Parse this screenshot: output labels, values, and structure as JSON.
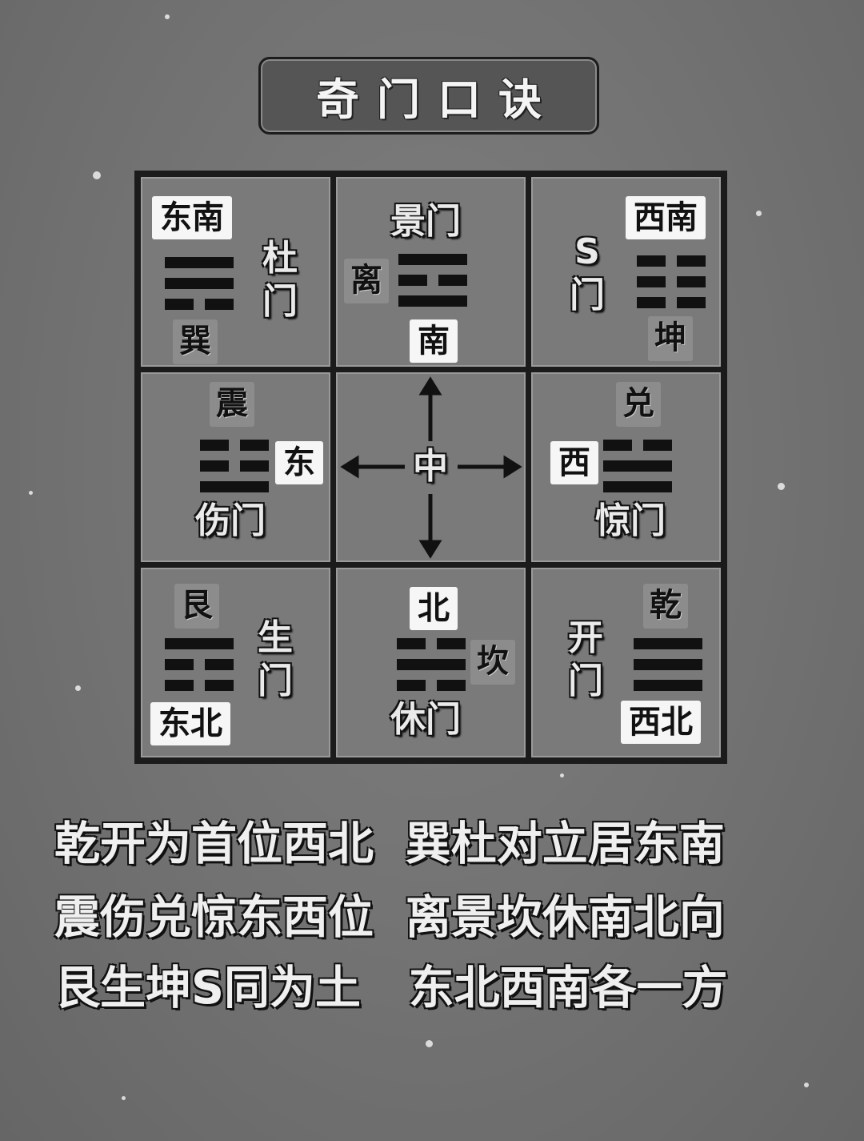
{
  "title": "奇门口诀",
  "palaces": {
    "southeast": {
      "direction": "东南",
      "trigram": "巽",
      "door": "杜门"
    },
    "south": {
      "direction": "南",
      "trigram": "离",
      "door": "景门"
    },
    "southwest": {
      "direction": "西南",
      "trigram": "坤",
      "door": "S门"
    },
    "east": {
      "direction": "东",
      "trigram": "震",
      "door": "伤门"
    },
    "center": {
      "label": "中"
    },
    "west": {
      "direction": "西",
      "trigram": "兑",
      "door": "惊门"
    },
    "northeast": {
      "direction": "东北",
      "trigram": "艮",
      "door": "生门"
    },
    "north": {
      "direction": "北",
      "trigram": "坎",
      "door": "休门"
    },
    "northwest": {
      "direction": "西北",
      "trigram": "乾",
      "door": "开门"
    }
  },
  "verse": [
    "乾开为首位西北  巽杜对立居东南",
    "震伤兑惊东西位  离景坎休南北向",
    "艮生坤S同为土   东北西南各一方"
  ]
}
